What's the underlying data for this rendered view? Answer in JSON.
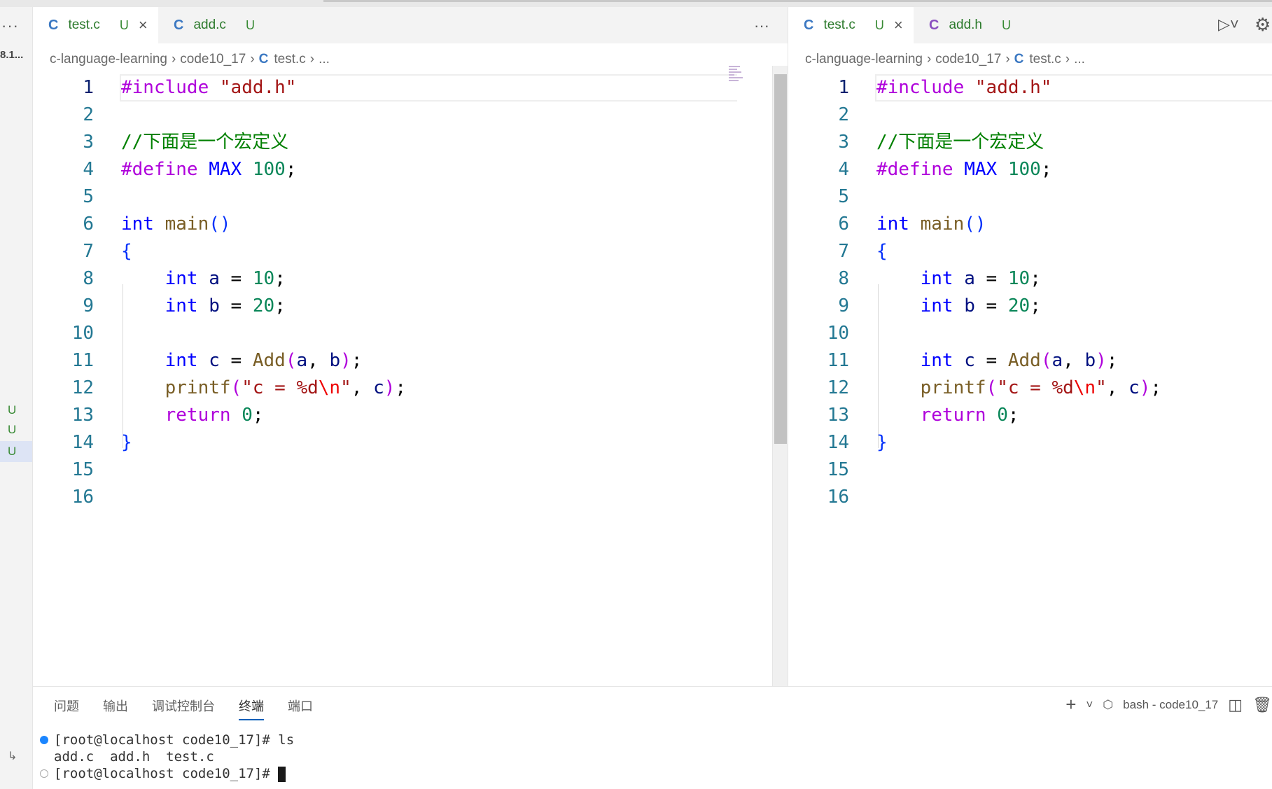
{
  "sidebar": {
    "more_label": "···",
    "truncated_label": "8.1...",
    "status_items": [
      "U",
      "U",
      "U"
    ],
    "arrow_icon": "↳"
  },
  "editors": [
    {
      "tabs": [
        {
          "icon": "C",
          "name": "test.c",
          "status": "U",
          "close": "×",
          "active": true
        },
        {
          "icon": "C",
          "name": "add.c",
          "status": "U",
          "active": false
        }
      ],
      "more": "···",
      "breadcrumb": {
        "folder": "c-language-learning",
        "subfolder": "code10_17",
        "icon": "C",
        "file": "test.c",
        "rest": "..."
      }
    },
    {
      "tabs": [
        {
          "icon": "C",
          "name": "test.c",
          "status": "U",
          "close": "×",
          "active": true
        },
        {
          "icon": "C",
          "name": "add.h",
          "status": "U",
          "active": false
        }
      ],
      "breadcrumb": {
        "folder": "c-language-learning",
        "subfolder": "code10_17",
        "icon": "C",
        "file": "test.c",
        "rest": "..."
      }
    }
  ],
  "line_numbers": [
    "1",
    "2",
    "3",
    "4",
    "5",
    "6",
    "7",
    "8",
    "9",
    "10",
    "11",
    "12",
    "13",
    "14",
    "15",
    "16"
  ],
  "code": {
    "include_directive": "#include",
    "include_file": "\"add.h\"",
    "comment": "//下面是一个宏定义",
    "define_directive": "#define",
    "macro_name": "MAX",
    "macro_value": "100",
    "kw_int": "int",
    "main_name": "main",
    "var_a": "a",
    "val_a": "10",
    "var_b": "b",
    "val_b": "20",
    "var_c": "c",
    "add_fn": "Add",
    "printf_fn": "printf",
    "fmt_start": "\"c = %d",
    "fmt_escape": "\\n",
    "fmt_end": "\"",
    "kw_return": "return",
    "return_value": "0"
  },
  "panel": {
    "tabs": [
      "问题",
      "输出",
      "调试控制台",
      "终端",
      "端口"
    ],
    "active_tab": "终端",
    "terminal_name": "bash - code10_17",
    "terminal_lines": [
      "[root@localhost code10_17]# ls",
      "add.c  add.h  test.c",
      "[root@localhost code10_17]# "
    ]
  },
  "colors": {
    "keyword": "#0000ff",
    "control": "#af00db",
    "function": "#795e26",
    "number": "#098658",
    "string": "#a31515",
    "comment": "#008000",
    "git_untracked": "#388a34"
  }
}
